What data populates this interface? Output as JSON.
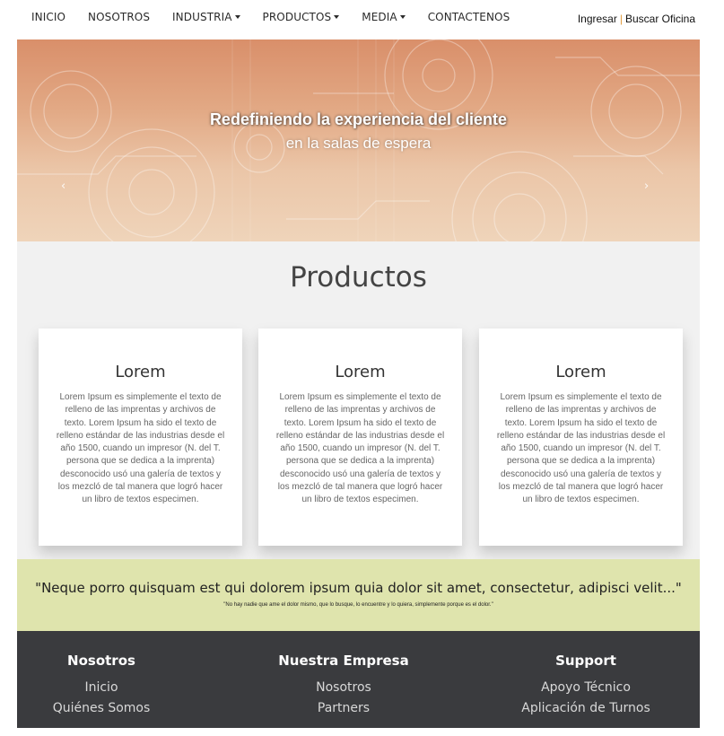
{
  "nav": {
    "items": [
      {
        "label": "INICIO",
        "dropdown": false
      },
      {
        "label": "NOSOTROS",
        "dropdown": false
      },
      {
        "label": "INDUSTRIA",
        "dropdown": true
      },
      {
        "label": "PRODUCTOS",
        "dropdown": true
      },
      {
        "label": "MEDIA",
        "dropdown": true
      },
      {
        "label": "CONTACTENOS",
        "dropdown": false
      }
    ],
    "login_label": "Ingresar",
    "separator": "|",
    "find_office_label": "Buscar Oficina"
  },
  "hero": {
    "title": "Redefiniendo la experiencia del cliente",
    "subtitle": "en la salas de espera",
    "prev_arrow": "‹",
    "next_arrow": "›"
  },
  "products": {
    "heading": "Productos",
    "cards": [
      {
        "title": "Lorem",
        "text": "Lorem Ipsum es simplemente el texto de relleno de las imprentas y archivos de texto. Lorem Ipsum ha sido el texto de relleno estándar de las industrias desde el año 1500, cuando un impresor (N. del T. persona que se dedica a la imprenta) desconocido usó una galería de textos y los mezcló de tal manera que logró hacer un libro de textos especimen."
      },
      {
        "title": "Lorem",
        "text": "Lorem Ipsum es simplemente el texto de relleno de las imprentas y archivos de texto. Lorem Ipsum ha sido el texto de relleno estándar de las industrias desde el año 1500, cuando un impresor (N. del T. persona que se dedica a la imprenta) desconocido usó una galería de textos y los mezcló de tal manera que logró hacer un libro de textos especimen."
      },
      {
        "title": "Lorem",
        "text": "Lorem Ipsum es simplemente el texto de relleno de las imprentas y archivos de texto. Lorem Ipsum ha sido el texto de relleno estándar de las industrias desde el año 1500, cuando un impresor (N. del T. persona que se dedica a la imprenta) desconocido usó una galería de textos y los mezcló de tal manera que logró hacer un libro de textos especimen."
      }
    ]
  },
  "quote": {
    "main": "\"Neque porro quisquam est qui dolorem ipsum quia dolor sit amet, consectetur, adipisci velit...\"",
    "sub": "\"No hay nadie que ame el dolor mismo, que lo busque, lo encuentre y lo quiera, simplemente porque es el dolor.\""
  },
  "footer": {
    "columns": [
      {
        "heading": "Nosotros",
        "links": [
          "Inicio",
          "Quiénes Somos"
        ]
      },
      {
        "heading": "Nuestra Empresa",
        "links": [
          "Nosotros",
          "Partners"
        ]
      },
      {
        "heading": "Support",
        "links": [
          "Apoyo Técnico",
          "Aplicación de Turnos"
        ]
      }
    ]
  },
  "colors": {
    "hero_top": "#d98f6a",
    "hero_bottom": "#efd4ba",
    "products_bg": "#f1f1f1",
    "quote_bg": "#dfe4ad",
    "footer_bg": "#3a3b3e",
    "nav_separator": "#e09a3a"
  }
}
